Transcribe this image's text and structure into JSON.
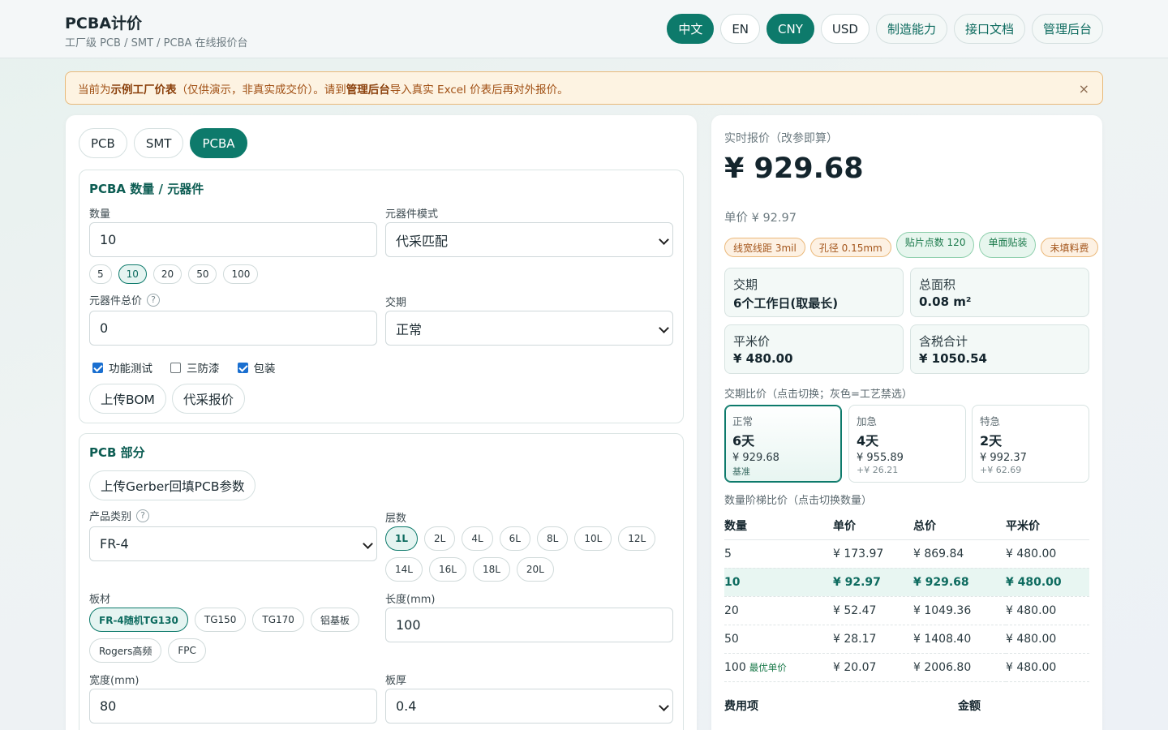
{
  "header": {
    "title": "PCBA计价",
    "subtitle": "工厂级 PCB / SMT / PCBA 在线报价台",
    "nav": [
      {
        "label": "中文",
        "active": true,
        "name": "lang-zh-button"
      },
      {
        "label": "EN",
        "active": false,
        "name": "lang-en-button"
      },
      {
        "label": "CNY",
        "active": true,
        "name": "currency-cny-button"
      },
      {
        "label": "USD",
        "active": false,
        "name": "currency-usd-button"
      },
      {
        "label": "制造能力",
        "active": false,
        "name": "capability-link"
      },
      {
        "label": "接口文档",
        "active": false,
        "name": "api-docs-link"
      },
      {
        "label": "管理后台",
        "active": false,
        "name": "admin-link"
      }
    ]
  },
  "notice": {
    "prefix": "当前为 ",
    "bold1": "示例工厂价表",
    "middle": "（仅供演示，非真实成交价）。请到 ",
    "bold2": "管理后台",
    "suffix": " 导入真实 Excel 价表后再对外报价。",
    "close": "×"
  },
  "tabs": [
    {
      "label": "PCB",
      "active": false
    },
    {
      "label": "SMT",
      "active": false
    },
    {
      "label": "PCBA",
      "active": true
    }
  ],
  "pcba": {
    "title": "PCBA 数量 / 元器件",
    "qty_label": "数量",
    "qty_value": "10",
    "qty_presets": [
      {
        "label": "5",
        "active": false
      },
      {
        "label": "10",
        "active": true
      },
      {
        "label": "20",
        "active": false
      },
      {
        "label": "50",
        "active": false
      },
      {
        "label": "100",
        "active": false
      }
    ],
    "mode_label": "元器件模式",
    "mode_value": "代采匹配",
    "comp_total_label": "元器件总价",
    "comp_total_value": "0",
    "help": "?",
    "leadtime_label": "交期",
    "leadtime_value": "正常",
    "checks": [
      {
        "label": "功能测试",
        "checked": true
      },
      {
        "label": "三防漆",
        "checked": false
      },
      {
        "label": "包装",
        "checked": true
      }
    ],
    "upload_bom": "上传BOM",
    "sourcing_quote": "代采报价"
  },
  "pcb": {
    "title": "PCB 部分",
    "upload_gerber": "上传Gerber回填PCB参数",
    "category_label": "产品类别",
    "category_value": "FR-4",
    "layers_label": "层数",
    "layers": [
      {
        "label": "1L",
        "active": true
      },
      {
        "label": "2L",
        "active": false
      },
      {
        "label": "4L",
        "active": false
      },
      {
        "label": "6L",
        "active": false
      },
      {
        "label": "8L",
        "active": false
      },
      {
        "label": "10L",
        "active": false
      },
      {
        "label": "12L",
        "active": false
      },
      {
        "label": "14L",
        "active": false
      },
      {
        "label": "16L",
        "active": false
      },
      {
        "label": "18L",
        "active": false
      },
      {
        "label": "20L",
        "active": false
      }
    ],
    "material_label": "板材",
    "materials": [
      {
        "label": "FR-4随机TG130",
        "active": true
      },
      {
        "label": "TG150",
        "active": false
      },
      {
        "label": "TG170",
        "active": false
      },
      {
        "label": "铝基板",
        "active": false
      },
      {
        "label": "Rogers高频",
        "active": false
      },
      {
        "label": "FPC",
        "active": false
      }
    ],
    "length_label": "长度(mm)",
    "length_value": "100",
    "width_label": "宽度(mm)",
    "width_value": "80",
    "thickness_label": "板厚",
    "thickness_value": "0.4"
  },
  "quote": {
    "label": "实时报价（改参即算）",
    "total": "¥ 929.68",
    "unit": "单价 ¥ 92.97",
    "tags": [
      {
        "label": "线宽线距 3mil",
        "kind": "warn"
      },
      {
        "label": "孔径 0.15mm",
        "kind": "warn"
      },
      {
        "label": "贴片点数 120",
        "kind": "ok"
      },
      {
        "label": "单面贴装",
        "kind": "ok"
      },
      {
        "label": "未填料费",
        "kind": "warn"
      }
    ],
    "stats": [
      {
        "key": "交期",
        "value": "6个工作日(取最长)"
      },
      {
        "key": "总面积",
        "value": "0.08 m²"
      },
      {
        "key": "平米价",
        "value": "¥ 480.00"
      },
      {
        "key": "含税合计",
        "value": "¥ 1050.54"
      }
    ],
    "speed_title": "交期比价（点击切换；灰色=工艺禁选）",
    "speeds": [
      {
        "name": "正常",
        "days": "6天",
        "price": "¥ 929.68",
        "extra": "基准",
        "active": true
      },
      {
        "name": "加急",
        "days": "4天",
        "price": "¥ 955.89",
        "extra": "+¥ 26.21",
        "active": false
      },
      {
        "name": "特急",
        "days": "2天",
        "price": "¥ 992.37",
        "extra": "+¥ 62.69",
        "active": false
      }
    ],
    "tier_title": "数量阶梯比价（点击切换数量）",
    "tier_headers": [
      "数量",
      "单价",
      "总价",
      "平米价"
    ],
    "tiers": [
      {
        "qty": "5",
        "unit": "¥ 173.97",
        "total": "¥ 869.84",
        "sqm": "¥ 480.00",
        "best": "",
        "active": false
      },
      {
        "qty": "10",
        "unit": "¥ 92.97",
        "total": "¥ 929.68",
        "sqm": "¥ 480.00",
        "best": "",
        "active": true
      },
      {
        "qty": "20",
        "unit": "¥ 52.47",
        "total": "¥ 1049.36",
        "sqm": "¥ 480.00",
        "best": "",
        "active": false
      },
      {
        "qty": "50",
        "unit": "¥ 28.17",
        "total": "¥ 1408.40",
        "sqm": "¥ 480.00",
        "best": "",
        "active": false
      },
      {
        "qty": "100",
        "unit": "¥ 20.07",
        "total": "¥ 2006.80",
        "sqm": "¥ 480.00",
        "best": "最优单价",
        "active": false
      }
    ],
    "fee_headers": [
      "费用项",
      "金额"
    ]
  },
  "colors": {
    "accent": "#0d7a6b",
    "warn": "#a4561c",
    "ok": "#1b7a4b"
  }
}
